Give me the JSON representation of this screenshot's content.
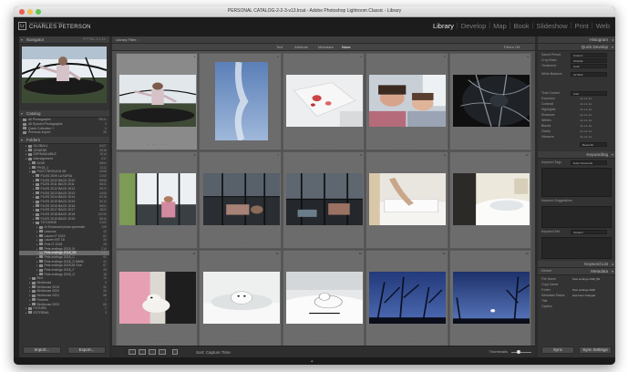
{
  "window": {
    "title": "PERSONAL CATALOG-2-2-3-v13.lrcat - Adobe Photoshop Lightroom Classic - Library"
  },
  "identity": {
    "subtitle": "Adobe Lightroom Classic",
    "name": "CHARLES PETERSON"
  },
  "modules": [
    "Library",
    "Develop",
    "Map",
    "Book",
    "Slideshow",
    "Print",
    "Web"
  ],
  "active_module": "Library",
  "left_panel": {
    "navigator_label": "Navigator",
    "navigator_zoom": "FIT  FILL  1:1  3:1",
    "catalog_label": "Catalog",
    "catalog_items": [
      {
        "label": "All Photographs",
        "count": "78511"
      },
      {
        "label": "All Synced Photographs",
        "count": "0"
      },
      {
        "label": "Quick Collection +",
        "count": "0"
      },
      {
        "label": "Previous Import",
        "count": "26"
      }
    ],
    "folders_label": "Folders",
    "folders": [
      {
        "label": "GLOBAL1",
        "count": "8427",
        "depth": 1
      },
      {
        "label": "GRUENE",
        "count": "2518",
        "depth": 1
      },
      {
        "label": "DSPAVAILABLE",
        "count": "1014",
        "depth": 1
      },
      {
        "label": "Intersignment",
        "count": "617",
        "depth": 1
      },
      {
        "label": "AYAS",
        "count": "6891",
        "depth": 2
      },
      {
        "label": "PH15_1",
        "count": "2112",
        "depth": 2
      },
      {
        "label": "PICS THROUGH 08",
        "count": "4008",
        "depth": 2
      },
      {
        "label": "FILES 2009 LUXURIA",
        "count": "2102",
        "depth": 3
      },
      {
        "label": "FILES 2010 BACK 2010",
        "count": "8968",
        "depth": 3
      },
      {
        "label": "FILES 2011 BACK 2011",
        "count": "6641",
        "depth": 3
      },
      {
        "label": "FILES 2012 BACK 2012",
        "count": "5570",
        "depth": 3
      },
      {
        "label": "FILES 2013 BACK 2013",
        "count": "4406",
        "depth": 3
      },
      {
        "label": "FILES 2014 BACK 2014",
        "count": "6218",
        "depth": 3
      },
      {
        "label": "FILES 2015 BACK 2015",
        "count": "5012",
        "depth": 3
      },
      {
        "label": "FILES 2016 BACK 2016",
        "count": "5801",
        "depth": 3
      },
      {
        "label": "FILES 2017 BACK 2017",
        "count": "4820",
        "depth": 3
      },
      {
        "label": "FILES 2018 BACK 2018",
        "count": "10232",
        "depth": 3
      },
      {
        "label": "FILES 2019 BACK 2019",
        "count": "5810",
        "depth": 3
      },
      {
        "label": "TO DIVIDE",
        "count": "3102",
        "depth": 3
      },
      {
        "label": "AI Enhanced photo generate",
        "count": "125",
        "depth": 4
      },
      {
        "label": "Lessons",
        "count": "42",
        "depth": 4
      },
      {
        "label": "Lauren P 2019",
        "count": "61",
        "depth": 4
      },
      {
        "label": "Lauren INT 18",
        "count": "34",
        "depth": 4
      },
      {
        "label": "Pets IT 2018",
        "count": "28",
        "depth": 4
      },
      {
        "label": "Pets endings 2018_B",
        "count": "214",
        "depth": 4
      },
      {
        "label": "Pets endings 2018_B2",
        "count": "119",
        "depth": 4,
        "selected": true
      },
      {
        "label": "Pets endings 2018_C",
        "count": "92",
        "depth": 4
      },
      {
        "label": "Pets endings 2018_D MMM",
        "count": "41",
        "depth": 4
      },
      {
        "label": "Pets endings 2018 All One",
        "count": "67",
        "depth": 4
      },
      {
        "label": "Pets endings 2018_F",
        "count": "25",
        "depth": 4
      },
      {
        "label": "Pets endings 2018_G",
        "count": "18",
        "depth": 4
      },
      {
        "label": "Bird",
        "count": "12",
        "depth": 2
      },
      {
        "label": "Birdhouse",
        "count": "9",
        "depth": 2
      },
      {
        "label": "Birdhouse 2019",
        "count": "31",
        "depth": 2
      },
      {
        "label": "Birdhouse 2020",
        "count": "44",
        "depth": 2
      },
      {
        "label": "Birdhouse 2021",
        "count": "58",
        "depth": 2
      },
      {
        "label": "Flowers",
        "count": "7",
        "depth": 2
      },
      {
        "label": "Birdhouse 2022",
        "count": "66",
        "depth": 2
      },
      {
        "label": "FUTURA",
        "count": "1",
        "depth": 1
      },
      {
        "label": "ESTREMA",
        "count": "3",
        "depth": 1
      }
    ],
    "import_label": "Import...",
    "export_label": "Export..."
  },
  "center": {
    "library_filter": "Library Filter :",
    "filters": [
      "Text",
      "Attribute",
      "Metadata",
      "None"
    ],
    "active_filter": "None",
    "filters_off": "Filters Off",
    "sort_label": "Sort:  Capture Time",
    "thumbnails_label": "Thumbnails",
    "cells": [
      {
        "idx": "1",
        "dims": "6016 x 4016",
        "thumb": "trampoline"
      },
      {
        "idx": "2",
        "dims": "4032 x 3024",
        "thumb": "sky"
      },
      {
        "idx": "3",
        "dims": "4032 x 3024",
        "thumb": "paper"
      },
      {
        "idx": "4",
        "dims": "4032 x 3024",
        "thumb": "kids"
      },
      {
        "idx": "5",
        "dims": "4032 x 3024",
        "thumb": "fisheye"
      },
      {
        "idx": "6",
        "dims": "4032 x 3024",
        "thumb": "tent"
      },
      {
        "idx": "7",
        "dims": "4032 x 3024",
        "thumb": "tentdark"
      },
      {
        "idx": "8",
        "dims": "4032 x 3024",
        "thumb": "tentdark2"
      },
      {
        "idx": "9",
        "dims": "4032 x 3024",
        "thumb": "bath"
      },
      {
        "idx": "10",
        "dims": "4032 x 3024",
        "thumb": "bath2"
      },
      {
        "idx": "11",
        "dims": "4032 x 3024",
        "thumb": "dogpink"
      },
      {
        "idx": "12",
        "dims": "4032 x 3024",
        "thumb": "dogbath"
      },
      {
        "idx": "13",
        "dims": "4032 x 3024",
        "thumb": "dogbath2"
      },
      {
        "idx": "14",
        "dims": "4032 x 3024",
        "thumb": "night"
      },
      {
        "idx": "15",
        "dims": "4032 x 3024",
        "thumb": "night2"
      }
    ]
  },
  "right_panel": {
    "histogram_label": "Histogram",
    "quick_develop_label": "Quick Develop",
    "saved_preset_label": "Saved Preset",
    "saved_preset_value": "Custom",
    "crop_ratio_label": "Crop Ratio",
    "crop_ratio_value": "Original",
    "treatment_label": "Treatment",
    "treatment_value": "Color",
    "white_balance_label": "White Balance",
    "white_balance_value": "As Shot",
    "tone_control_label": "Tone Control",
    "tone_control_value": "Auto",
    "tone_rows": [
      "Exposure",
      "Contrast",
      "Highlights",
      "Shadows",
      "Whites",
      "Blacks",
      "Clarity",
      "Vibrance"
    ],
    "reset_all": "Reset All",
    "keywording_label": "Keywording",
    "keyword_tags_label": "Keyword Tags",
    "keyword_tags_value": "Enter Keywords",
    "keyword_suggestions_label": "Keyword Suggestions",
    "keyword_set_label": "Keyword Set",
    "keyword_set_value": "Outdoor",
    "keyword_list_label": "Keyword List",
    "metadata_label": "Metadata",
    "metadata_preset": "Default",
    "metadata_rows": [
      {
        "label": "File Name",
        "value": "Pets endings 2018_B2"
      },
      {
        "label": "Copy Name",
        "value": ""
      },
      {
        "label": "Folder",
        "value": "Pets endings 2018"
      },
      {
        "label": "Metadata Status",
        "value": "Has been changed"
      },
      {
        "label": "Title",
        "value": ""
      },
      {
        "label": "Caption",
        "value": ""
      }
    ],
    "sync_label": "Sync",
    "sync_settings_label": "Sync Settings"
  }
}
